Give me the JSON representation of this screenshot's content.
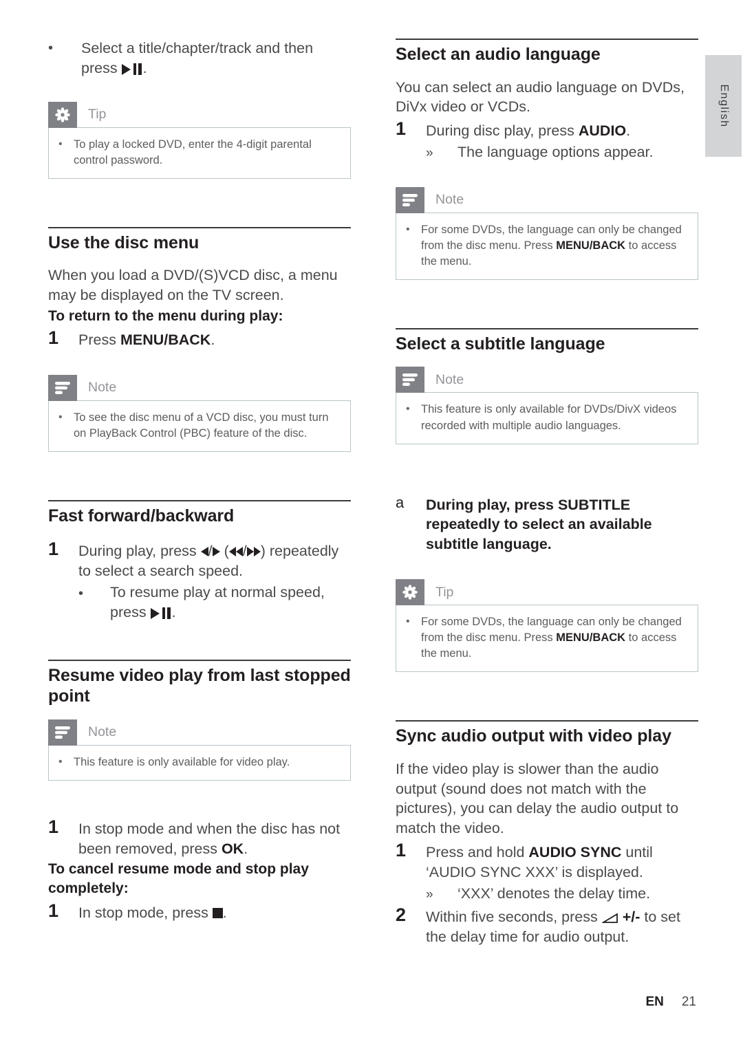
{
  "page": {
    "language_tab": "English",
    "footer_code": "EN",
    "footer_page": "21"
  },
  "left_column": {
    "intro_bullet": {
      "bullet": "•",
      "text_before": "Select a title/chapter/track and then press",
      "icon": "play-pause-icon",
      "text_after": "."
    },
    "tip_1": {
      "icon": "tip-asterisk-icon",
      "label": "Tip",
      "bullet": "•",
      "text": "To play a locked DVD, enter the 4-digit parental control password."
    },
    "section_disc_menu": {
      "title": "Use the disc menu",
      "paragraph": "When you load a DVD/(S)VCD disc, a menu may be displayed on the TV screen.",
      "sub_head": "To return to the menu during play:",
      "step_1_num": "1",
      "step_1_text_before": "Press ",
      "step_1_bold": "MENU/BACK",
      "step_1_text_after": ".",
      "note": {
        "icon": "note-lines-icon",
        "label": "Note",
        "bullet": "•",
        "text": "To see the disc menu of a VCD disc, you must turn on PlayBack Control (PBC) feature of the disc."
      }
    },
    "section_fast_forward": {
      "title": "Fast forward/backward",
      "step_1_num": "1",
      "step_1_text_a": "During play, press ",
      "step_1_icon_a": "prev-next-icon",
      "step_1_text_b": " (",
      "step_1_icon_b": "rewind-fastforward-icon",
      "step_1_text_c": ") repeatedly to select a search speed.",
      "sub_bullet": "•",
      "sub_text_before": "To resume play at normal speed, press",
      "sub_icon": "play-pause-icon",
      "sub_text_after": "."
    },
    "section_resume": {
      "title": "Resume video play from last stopped point",
      "note": {
        "icon": "note-lines-icon",
        "label": "Note",
        "bullet": "•",
        "text": "This feature is only available for video play."
      },
      "step_1_num": "1",
      "step_1_text_before": "In stop mode and when the disc has not been removed, press ",
      "step_1_bold": "OK",
      "step_1_text_after": ".",
      "sub_head": "To cancel resume mode and stop play completely:",
      "step_2_num": "1",
      "step_2_text_before": "In stop mode, press ",
      "step_2_icon": "stop-icon",
      "step_2_text_after": "."
    }
  },
  "right_column": {
    "section_audio_language": {
      "title": "Select an audio language",
      "paragraph": "You can select an audio language on DVDs, DiVx video or VCDs.",
      "step_1_num": "1",
      "step_1_text_before": "During disc play, press ",
      "step_1_bold": "AUDIO",
      "step_1_text_after": ".",
      "arrow": "»",
      "arrow_text": "The language options appear.",
      "note": {
        "icon": "note-lines-icon",
        "label": "Note",
        "bullet": "•",
        "text_before": "For some DVDs, the language can only be changed from the disc menu. Press ",
        "text_bold": "MENU/BACK",
        "text_after": " to access the menu."
      }
    },
    "section_subtitle_language": {
      "title": "Select a subtitle language",
      "note": {
        "icon": "note-lines-icon",
        "label": "Note",
        "bullet": "•",
        "text": "This feature is only available for DVDs/DivX videos recorded with multiple audio languages."
      },
      "step_a_num": "a",
      "step_a_text": "During play, press SUBTITLE repeatedly to select an available subtitle language.",
      "tip": {
        "icon": "tip-asterisk-icon",
        "label": "Tip",
        "bullet": "•",
        "text_before": "For some DVDs, the language can only be changed from the disc menu. Press ",
        "text_bold": "MENU/BACK",
        "text_after": " to access the menu."
      }
    },
    "section_sync_audio": {
      "title": "Sync audio output with video play",
      "paragraph": "If the video play is slower than the audio output (sound does not match with the pictures), you can delay the audio output to match the video.",
      "step_1_num": "1",
      "step_1_text_before": "Press and hold ",
      "step_1_bold": "AUDIO SYNC",
      "step_1_text_after": " until ‘AUDIO SYNC XXX’ is displayed.",
      "arrow": "»",
      "arrow_text": "‘XXX’ denotes the delay time.",
      "step_2_num": "2",
      "step_2_text_before": "Within five seconds, press ",
      "step_2_icon": "volume-icon",
      "step_2_text_bold": " +/-",
      "step_2_text_after": " to set the delay time for audio output."
    }
  },
  "colors": {
    "callout_icon_bg": "#808186",
    "callout_label": "#939498",
    "callout_border": "#b9c4c9",
    "heading": "#231f20",
    "body": "#4a4a4d",
    "lang_tab_bg": "#d3d4d6"
  }
}
